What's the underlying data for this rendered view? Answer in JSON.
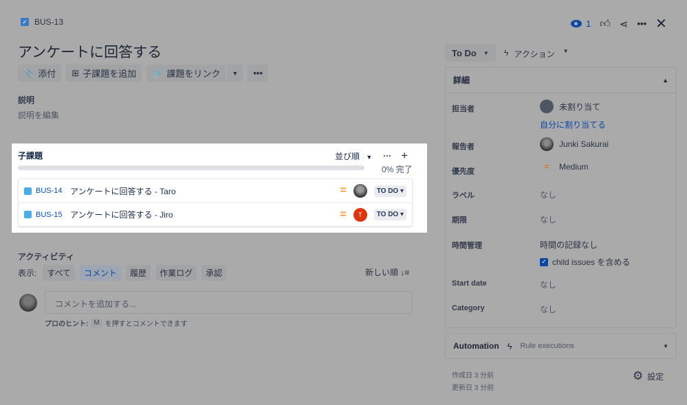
{
  "issue": {
    "key": "BUS-13",
    "title": "アンケートに回答する"
  },
  "toolbar": {
    "attach": "添付",
    "add_subtask": "子課題を追加",
    "link_issue": "課題をリンク"
  },
  "description": {
    "heading": "説明",
    "placeholder": "説明を編集"
  },
  "subtasks": {
    "heading": "子課題",
    "sort": "並び順",
    "progress_text": "0% 完了",
    "progress": 0,
    "items": [
      {
        "key": "BUS-14",
        "summary": "アンケートに回答する - Taro",
        "priority": "medium",
        "status": "TO DO",
        "assignee": "photo"
      },
      {
        "key": "BUS-15",
        "summary": "アンケートに回答する - Jiro",
        "priority": "medium",
        "status": "TO DO",
        "assignee": "T"
      }
    ]
  },
  "activity": {
    "heading": "アクティビティ",
    "show_label": "表示:",
    "filters": [
      "すべて",
      "コメント",
      "履歴",
      "作業ログ",
      "承認"
    ],
    "active_filter": "コメント",
    "sort": "新しい順",
    "comment_placeholder": "コメントを追加する...",
    "hint_prefix": "プロのヒント:",
    "hint_key": "M",
    "hint_suffix": "を押すとコメントできます"
  },
  "header": {
    "watchers": "1"
  },
  "status_button": "To Do",
  "actions_button": "アクション",
  "details": {
    "heading": "詳細",
    "assignee_label": "担当者",
    "assignee": "未割り当て",
    "assign_me": "自分に割り当てる",
    "reporter_label": "報告者",
    "reporter": "Junki Sakurai",
    "priority_label": "優先度",
    "priority": "Medium",
    "labels_label": "ラベル",
    "labels": "なし",
    "due_label": "期限",
    "due": "なし",
    "time_label": "時間管理",
    "time": "時間の記録なし",
    "child_issues": "child issues を含める",
    "start_label": "Start date",
    "start": "なし",
    "category_label": "Category",
    "category": "なし"
  },
  "automation": {
    "title": "Automation",
    "sub": "Rule executions"
  },
  "footer": {
    "created": "作成日 3 分前",
    "updated": "更新日 3 分前",
    "settings": "設定"
  },
  "colors": {
    "accent": "#0052cc",
    "priority_medium": "#ff991f",
    "avatar_t": "#de350b",
    "highlight": "#ffffff"
  }
}
